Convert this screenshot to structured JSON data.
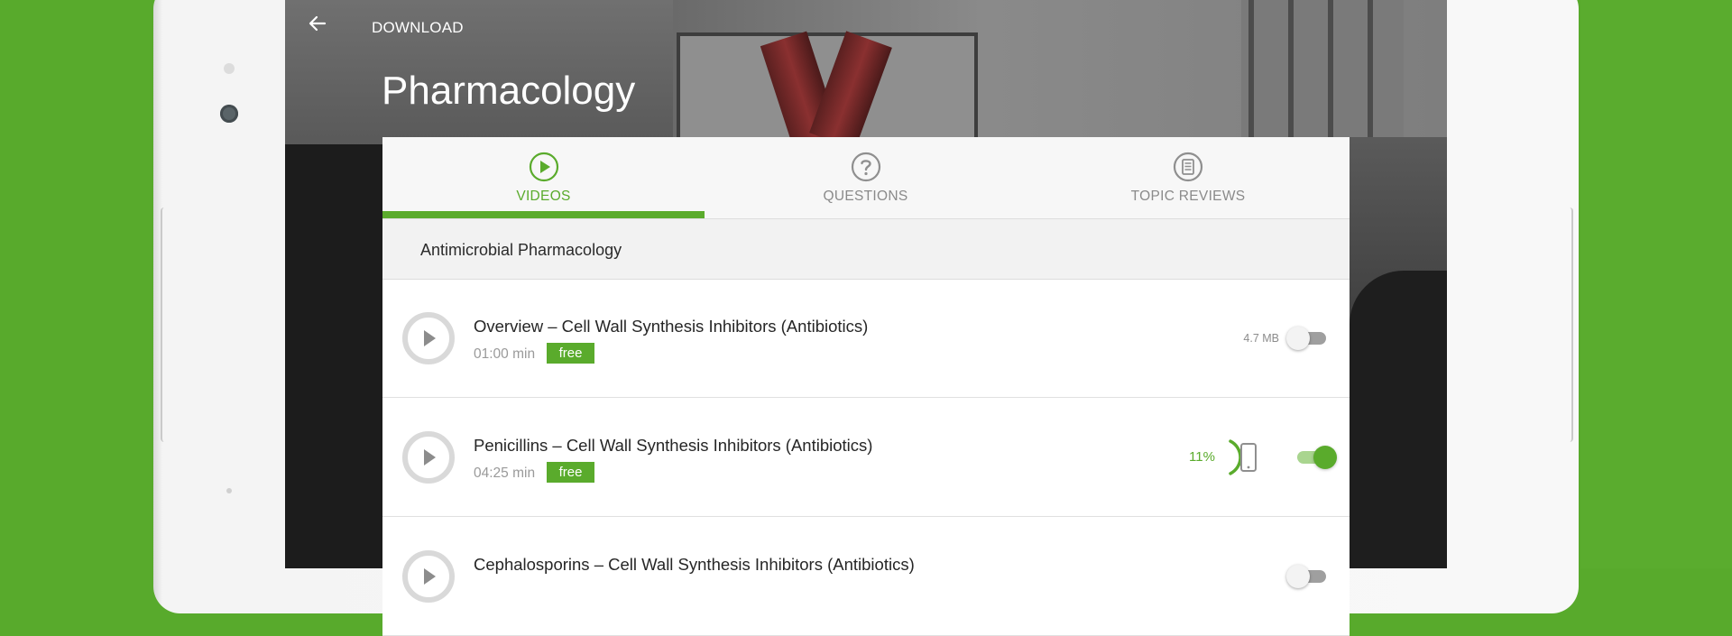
{
  "topbar": {
    "back_icon": "arrow-left-icon",
    "title": "DOWNLOAD"
  },
  "page": {
    "title": "Pharmacology"
  },
  "tabs": [
    {
      "label": "VIDEOS",
      "icon": "play-circle-icon",
      "active": true
    },
    {
      "label": "QUESTIONS",
      "icon": "question-circle-icon",
      "active": false
    },
    {
      "label": "TOPIC REVIEWS",
      "icon": "document-circle-icon",
      "active": false
    }
  ],
  "section": {
    "title": "Antimicrobial Pharmacology"
  },
  "videos": [
    {
      "title": "Overview – Cell Wall Synthesis Inhibitors (Antibiotics)",
      "duration": "01:00 min",
      "badge": "free",
      "size": "4.7 MB",
      "download_enabled": false
    },
    {
      "title": "Penicillins – Cell Wall Synthesis Inhibitors (Antibiotics)",
      "duration": "04:25 min",
      "badge": "free",
      "progress": "11%",
      "progress_fraction": 0.11,
      "storage_icon": "phone-icon",
      "download_enabled": true
    },
    {
      "title": "Cephalosporins – Cell Wall Synthesis Inhibitors (Antibiotics)",
      "download_enabled": false
    }
  ],
  "colors": {
    "brand_green": "#5aab2c",
    "background_green": "#58aa2c"
  }
}
